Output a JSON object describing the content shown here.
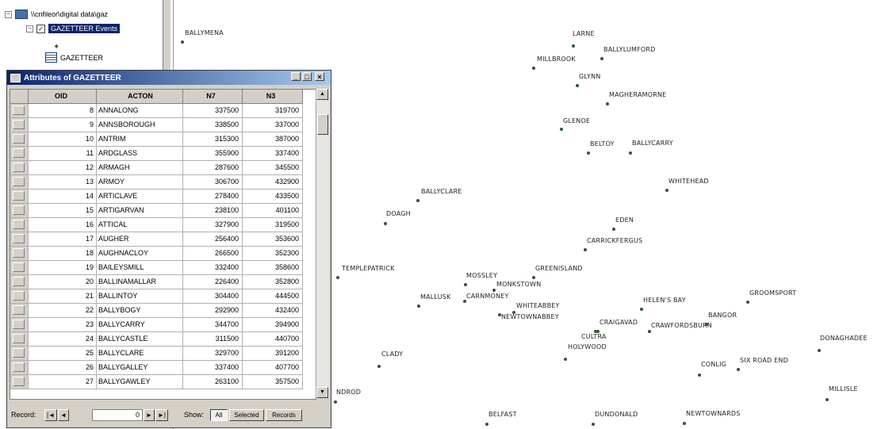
{
  "toc": {
    "path_label": "\\\\cnfileor\\digital data\\gaz",
    "event_layer_label": "GAZETTEER Events",
    "table_label": "GAZETTEER",
    "expand_minus": "−",
    "checkbox_checked": "✓"
  },
  "attr_window": {
    "title": "Attributes of GAZETTEER",
    "minimize": "_",
    "maximize": "□",
    "close": "×",
    "columns": [
      "OID",
      "ACTON",
      "N7",
      "N3"
    ],
    "rows": [
      {
        "oid": "8",
        "acton": "ANNALONG",
        "n7": "337500",
        "n3": "319700"
      },
      {
        "oid": "9",
        "acton": "ANNSBOROUGH",
        "n7": "338500",
        "n3": "337000"
      },
      {
        "oid": "10",
        "acton": "ANTRIM",
        "n7": "315300",
        "n3": "387000"
      },
      {
        "oid": "11",
        "acton": "ARDGLASS",
        "n7": "355900",
        "n3": "337400"
      },
      {
        "oid": "12",
        "acton": "ARMAGH",
        "n7": "287600",
        "n3": "345500"
      },
      {
        "oid": "13",
        "acton": "ARMOY",
        "n7": "306700",
        "n3": "432900"
      },
      {
        "oid": "14",
        "acton": "ARTICLAVE",
        "n7": "278400",
        "n3": "433500"
      },
      {
        "oid": "15",
        "acton": "ARTIGARVAN",
        "n7": "238100",
        "n3": "401100"
      },
      {
        "oid": "16",
        "acton": "ATTICAL",
        "n7": "327900",
        "n3": "319500"
      },
      {
        "oid": "17",
        "acton": "AUGHER",
        "n7": "256400",
        "n3": "353600"
      },
      {
        "oid": "18",
        "acton": "AUGHNACLOY",
        "n7": "266500",
        "n3": "352300"
      },
      {
        "oid": "19",
        "acton": "BAILEYSMILL",
        "n7": "332400",
        "n3": "358600"
      },
      {
        "oid": "20",
        "acton": "BALLINAMALLAR",
        "n7": "226400",
        "n3": "352800"
      },
      {
        "oid": "21",
        "acton": "BALLINTOY",
        "n7": "304400",
        "n3": "444500"
      },
      {
        "oid": "22",
        "acton": "BALLYBOGY",
        "n7": "292900",
        "n3": "432400"
      },
      {
        "oid": "23",
        "acton": "BALLYCARRY",
        "n7": "344700",
        "n3": "394900"
      },
      {
        "oid": "24",
        "acton": "BALLYCASTLE",
        "n7": "311500",
        "n3": "440700"
      },
      {
        "oid": "25",
        "acton": "BALLYCLARE",
        "n7": "329700",
        "n3": "391200"
      },
      {
        "oid": "26",
        "acton": "BALLYGALLEY",
        "n7": "337400",
        "n3": "407700"
      },
      {
        "oid": "27",
        "acton": "BALLYGAWLEY",
        "n7": "263100",
        "n3": "357500"
      }
    ],
    "nav": {
      "record_label": "Record:",
      "first": "|◄",
      "prev": "◄",
      "current": "0",
      "next": "►",
      "last": "►|",
      "show_label": "Show:",
      "all": "All",
      "selected": "Selected",
      "records_label": "Records"
    }
  },
  "map": {
    "point_color": "#2e5a2e",
    "towns": [
      {
        "name": "BALLYMENA"
      },
      {
        "name": "LARNE"
      },
      {
        "name": "BALLYLUMFORD"
      },
      {
        "name": "MILLBROOK"
      },
      {
        "name": "GLYNN"
      },
      {
        "name": "MAGHERAMORNE"
      },
      {
        "name": "GLENOE"
      },
      {
        "name": "BELTOY"
      },
      {
        "name": "BALLYCARRY"
      },
      {
        "name": "WHITEHEAD"
      },
      {
        "name": "BALLYCLARE"
      },
      {
        "name": "DOAGH"
      },
      {
        "name": "EDEN"
      },
      {
        "name": "CARRICKFERGUS"
      },
      {
        "name": "TEMPLEPATRICK"
      },
      {
        "name": "MOSSLEY"
      },
      {
        "name": "GREENISLAND"
      },
      {
        "name": "MONKSTOWN"
      },
      {
        "name": "MALLUSK"
      },
      {
        "name": "CARNMONEY"
      },
      {
        "name": "WHITEABBEY"
      },
      {
        "name": "NEWTOWNABBEY"
      },
      {
        "name": "HELEN'S BAY"
      },
      {
        "name": "GROOMSPORT"
      },
      {
        "name": "BANGOR"
      },
      {
        "name": "CRAIGAVAD"
      },
      {
        "name": "CRAWFORDSBURN"
      },
      {
        "name": "CULTRA"
      },
      {
        "name": "HOLYWOOD"
      },
      {
        "name": "CLADY"
      },
      {
        "name": "DONAGHADEE"
      },
      {
        "name": "CONLIG"
      },
      {
        "name": "SIX ROAD END"
      },
      {
        "name": "MILLISLE"
      },
      {
        "name": "NDROD"
      },
      {
        "name": "BELFAST"
      },
      {
        "name": "DUNDONALD"
      },
      {
        "name": "NEWTOWNARDS"
      }
    ]
  }
}
